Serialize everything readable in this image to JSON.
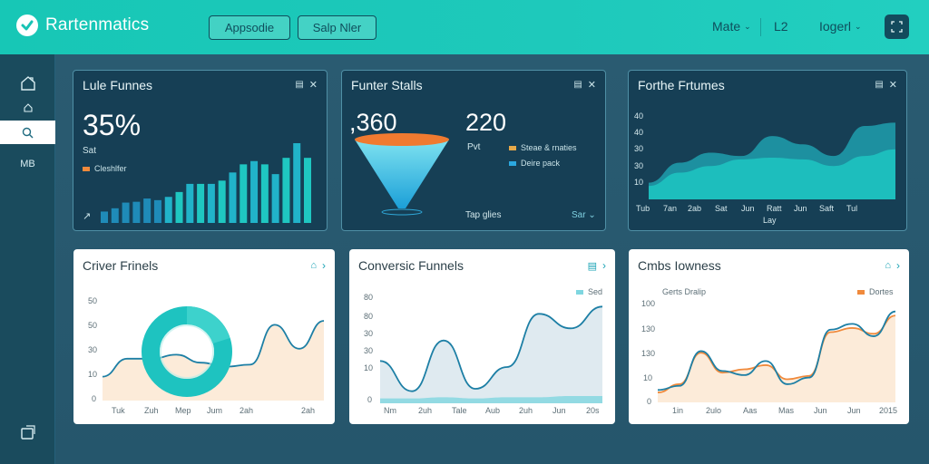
{
  "header": {
    "brand": "Rartenmatics",
    "btn_primary": "Appsodie",
    "btn_secondary": "Salp Nler",
    "link_1": "Mate",
    "link_2": "L2",
    "link_3": "Iogerl"
  },
  "sidebar": {
    "item_text": "MB"
  },
  "cards": {
    "lule": {
      "title": "Lule Funnes",
      "value": "35%",
      "sub": "Sat",
      "legend": "Cleshlfer"
    },
    "funnel": {
      "title": "Funter Stalls",
      "value_a": ",360",
      "value_b": "220",
      "sub": "Pvt",
      "legend_1": "Steae & rnaties",
      "legend_2": "Deire pack",
      "footer_left": "Tap glies",
      "footer_right": "Sar"
    },
    "forthe": {
      "title": "Forthe Frtumes",
      "y_ticks": [
        "40",
        "40",
        "30",
        "30",
        "10"
      ],
      "x_ticks": [
        "Tub",
        "7an",
        "2ab",
        "Sat",
        "Jun",
        "Ratt",
        "Jun",
        "Saft",
        "Tul"
      ],
      "x_label": "Lay"
    },
    "criver": {
      "title": "Criver Frinels",
      "y_ticks": [
        "50",
        "50",
        "30",
        "10",
        "0"
      ],
      "x_ticks": [
        "Tuk",
        "Zuh",
        "Mep",
        "Jum",
        "2ah",
        "2ah"
      ]
    },
    "conversic": {
      "title": "Conversic Funnels",
      "legend": "Sed",
      "y_ticks": [
        "80",
        "80",
        "30",
        "30",
        "10",
        "0"
      ],
      "x_ticks": [
        "Nm",
        "2uh",
        "Tale",
        "Aub",
        "2uh",
        "Jun",
        "20s"
      ]
    },
    "cmbs": {
      "title": "Cmbs Iowness",
      "legend_left": "Gerts Dralip",
      "legend_right": "Dortes",
      "y_ticks": [
        "100",
        "130",
        "130",
        "10",
        "0"
      ],
      "x_ticks": [
        "1in",
        "2ulo",
        "Aas",
        "Mas",
        "Jun",
        "Jun",
        "2015"
      ]
    }
  },
  "colors": {
    "teal": "#1ec3c0",
    "orange": "#f08a3c",
    "blue": "#1f8bb8",
    "dark_card": "#163f55"
  },
  "chart_data": [
    {
      "type": "bar",
      "values": [
        14,
        18,
        25,
        26,
        30,
        28,
        32,
        38,
        48,
        48,
        48,
        52,
        62,
        72,
        76,
        72,
        60,
        80,
        98,
        80
      ]
    },
    {
      "type": "area",
      "x": [
        "Tub",
        "7an",
        "2ab",
        "Sat",
        "Jun",
        "Ratt",
        "Jun",
        "Saft",
        "Tul"
      ],
      "series": [
        {
          "values": [
            10,
            22,
            28,
            26,
            38,
            33,
            26,
            44,
            46
          ]
        },
        {
          "values": [
            8,
            16,
            20,
            24,
            25,
            24,
            20,
            26,
            30
          ]
        }
      ]
    },
    {
      "type": "line",
      "x": [
        "Tuk",
        "Zuh",
        "Mep",
        "Jum",
        "2ah",
        "2ah"
      ],
      "y_range": [
        0,
        50
      ],
      "series": [
        {
          "values": [
            12,
            21,
            21,
            23,
            19,
            17,
            18,
            38,
            26,
            40
          ]
        }
      ]
    },
    {
      "type": "area",
      "x": [
        "Nm",
        "2uh",
        "Tale",
        "Aub",
        "2uh",
        "Jun",
        "20s"
      ],
      "y_range": [
        0,
        80
      ],
      "series": [
        {
          "name": "Sed",
          "values": [
            35,
            10,
            52,
            12,
            30,
            74,
            62,
            80
          ]
        },
        {
          "values": [
            4,
            4,
            5,
            4,
            5,
            5,
            6,
            6
          ]
        }
      ]
    },
    {
      "type": "line",
      "x": [
        "1in",
        "2ulo",
        "Aas",
        "Mas",
        "Jun",
        "Jun",
        "2015"
      ],
      "y_range": [
        0,
        130
      ],
      "series": [
        {
          "values": [
            15,
            20,
            62,
            38,
            33,
            50,
            22,
            30,
            88,
            95,
            80,
            110
          ]
        },
        {
          "name": "Dortes",
          "values": [
            12,
            22,
            60,
            36,
            40,
            45,
            28,
            32,
            85,
            90,
            83,
            105
          ]
        }
      ]
    }
  ]
}
